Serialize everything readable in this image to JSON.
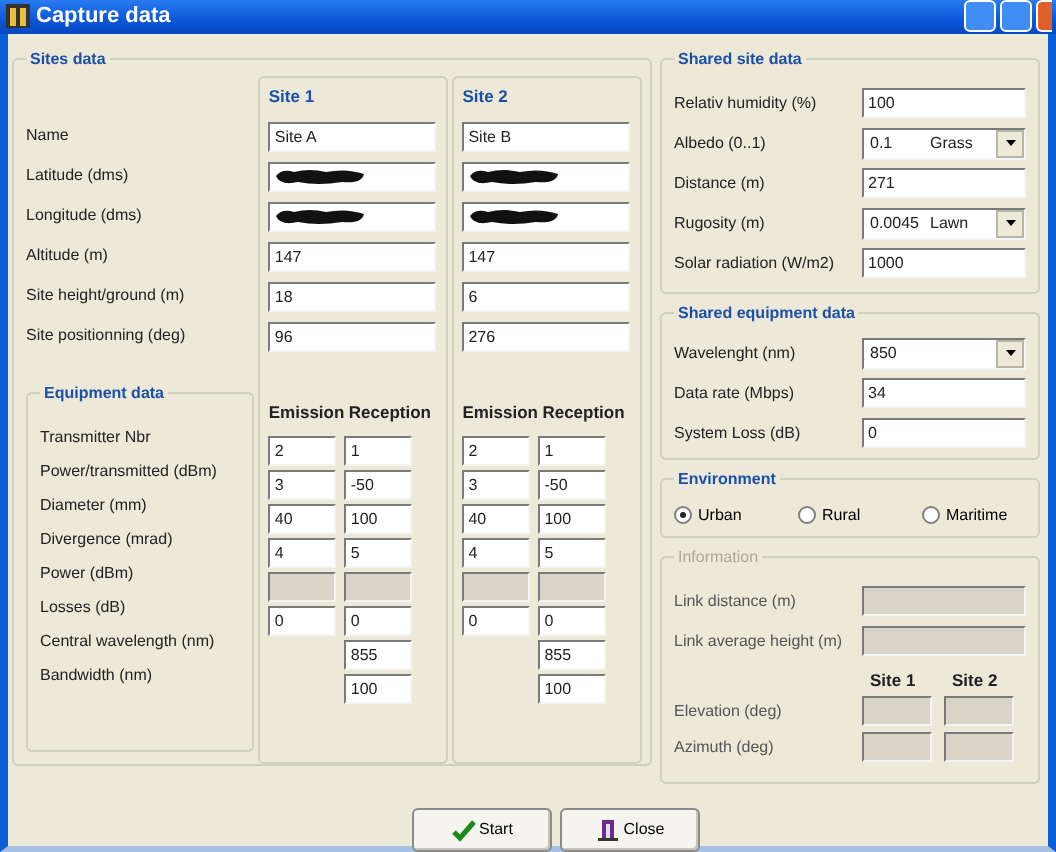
{
  "window": {
    "title": "Capture data"
  },
  "sites_data": {
    "title": "Sites data",
    "site_headers": [
      "Site 1",
      "Site 2"
    ],
    "rows": [
      {
        "label": "Name",
        "cells": [
          {
            "kind": "field",
            "value": "Site A"
          },
          {
            "kind": "field",
            "value": "Site B"
          }
        ]
      },
      {
        "label": "Latitude (dms)",
        "cells": [
          {
            "kind": "redacted"
          },
          {
            "kind": "redacted"
          }
        ]
      },
      {
        "label": "Longitude (dms)",
        "cells": [
          {
            "kind": "redacted"
          },
          {
            "kind": "redacted"
          }
        ]
      },
      {
        "label": "Altitude (m)",
        "cells": [
          {
            "kind": "field",
            "value": "147"
          },
          {
            "kind": "field",
            "value": "147"
          }
        ]
      },
      {
        "label": "Site height/ground (m)",
        "cells": [
          {
            "kind": "field",
            "value": "18"
          },
          {
            "kind": "field",
            "value": "6"
          }
        ]
      },
      {
        "label": "Site positionning (deg)",
        "cells": [
          {
            "kind": "field",
            "value": "96"
          },
          {
            "kind": "field",
            "value": "276"
          }
        ]
      }
    ]
  },
  "equipment_data": {
    "title": "Equipment data",
    "column_headers": [
      "Emission",
      "Reception",
      "Emission",
      "Reception"
    ],
    "rows": [
      {
        "label": "Transmitter Nbr",
        "cells": [
          {
            "kind": "field",
            "value": "2"
          },
          {
            "kind": "field",
            "value": "1"
          },
          {
            "kind": "field",
            "value": "2"
          },
          {
            "kind": "field",
            "value": "1"
          }
        ]
      },
      {
        "label": "Power/transmitted (dBm)",
        "cells": [
          {
            "kind": "field",
            "value": "3"
          },
          {
            "kind": "field",
            "value": "-50"
          },
          {
            "kind": "field",
            "value": "3"
          },
          {
            "kind": "field",
            "value": "-50"
          }
        ]
      },
      {
        "label": "Diameter (mm)",
        "cells": [
          {
            "kind": "field",
            "value": "40"
          },
          {
            "kind": "field",
            "value": "100"
          },
          {
            "kind": "field",
            "value": "40"
          },
          {
            "kind": "field",
            "value": "100"
          }
        ]
      },
      {
        "label": "Divergence (mrad)",
        "cells": [
          {
            "kind": "field",
            "value": "4"
          },
          {
            "kind": "field",
            "value": "5"
          },
          {
            "kind": "field",
            "value": "4"
          },
          {
            "kind": "field",
            "value": "5"
          }
        ]
      },
      {
        "label": "Power (dBm)",
        "cells": [
          {
            "kind": "disabled"
          },
          {
            "kind": "disabled"
          },
          {
            "kind": "disabled"
          },
          {
            "kind": "disabled"
          }
        ]
      },
      {
        "label": "Losses (dB)",
        "cells": [
          {
            "kind": "field",
            "value": "0"
          },
          {
            "kind": "field",
            "value": "0"
          },
          {
            "kind": "field",
            "value": "0"
          },
          {
            "kind": "field",
            "value": "0"
          }
        ]
      },
      {
        "label": "Central wavelength (nm)",
        "cells": [
          {
            "kind": "empty"
          },
          {
            "kind": "field",
            "value": "855"
          },
          {
            "kind": "empty"
          },
          {
            "kind": "field",
            "value": "855"
          }
        ]
      },
      {
        "label": "Bandwidth (nm)",
        "cells": [
          {
            "kind": "empty"
          },
          {
            "kind": "field",
            "value": "100"
          },
          {
            "kind": "empty"
          },
          {
            "kind": "field",
            "value": "100"
          }
        ]
      }
    ]
  },
  "shared_site_data": {
    "title": "Shared site data",
    "rows": [
      {
        "label": "Relativ humidity (%)",
        "kind": "field",
        "value": "100"
      },
      {
        "label": "Albedo (0..1)",
        "kind": "select",
        "value": "0.1",
        "note": "Grass"
      },
      {
        "label": "Distance (m)",
        "kind": "field",
        "value": "271"
      },
      {
        "label": "Rugosity (m)",
        "kind": "select",
        "value": "0.0045",
        "note": "Lawn"
      },
      {
        "label": "Solar radiation (W/m2)",
        "kind": "field",
        "value": "1000"
      }
    ]
  },
  "shared_equipment_data": {
    "title": "Shared equipment data",
    "rows": [
      {
        "label": "Wavelenght (nm)",
        "kind": "select",
        "value": "850"
      },
      {
        "label": "Data rate (Mbps)",
        "kind": "field",
        "value": "34"
      },
      {
        "label": "System Loss (dB)",
        "kind": "field",
        "value": "0"
      }
    ]
  },
  "environment": {
    "title": "Environment",
    "options": [
      {
        "label": "Urban",
        "selected": true
      },
      {
        "label": "Rural",
        "selected": false
      },
      {
        "label": "Maritime",
        "selected": false
      }
    ]
  },
  "information": {
    "title": "Information",
    "disabled": true,
    "rows": [
      {
        "label": "Link distance (m)"
      },
      {
        "label": "Link average height (m)"
      }
    ],
    "site_headers": [
      "Site 1",
      "Site 2"
    ],
    "site_rows": [
      {
        "label": "Elevation (deg)"
      },
      {
        "label": "Azimuth (deg)"
      }
    ]
  },
  "buttons": [
    {
      "label": "Start",
      "kind": "start"
    },
    {
      "label": "Close",
      "kind": "close"
    }
  ]
}
